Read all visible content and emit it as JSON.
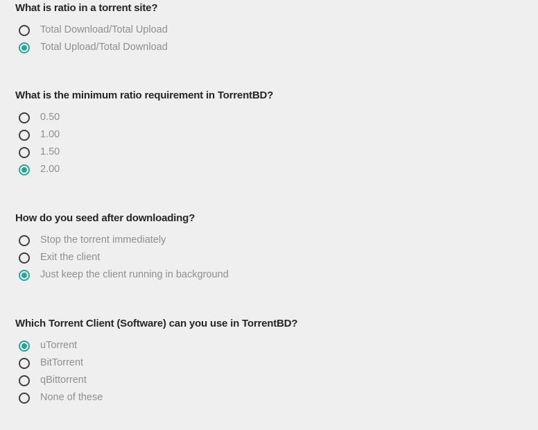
{
  "questions": [
    {
      "title": "What is ratio in a torrent site?",
      "options": [
        {
          "label": "Total Download/Total Upload",
          "checked": false
        },
        {
          "label": "Total Upload/Total Download",
          "checked": true
        }
      ]
    },
    {
      "title": "What is the minimum ratio requirement in TorrentBD?",
      "options": [
        {
          "label": "0.50",
          "checked": false
        },
        {
          "label": "1.00",
          "checked": false
        },
        {
          "label": "1.50",
          "checked": false
        },
        {
          "label": "2.00",
          "checked": true
        }
      ]
    },
    {
      "title": "How do you seed after downloading?",
      "options": [
        {
          "label": "Stop the torrent immediately",
          "checked": false
        },
        {
          "label": "Exit the client",
          "checked": false
        },
        {
          "label": "Just keep the client running in background",
          "checked": true
        }
      ]
    },
    {
      "title": "Which Torrent Client (Software) can you use in TorrentBD?",
      "options": [
        {
          "label": "uTorrent",
          "checked": true
        },
        {
          "label": "BitTorrent",
          "checked": false
        },
        {
          "label": "qBittorrent",
          "checked": false
        },
        {
          "label": "None of these",
          "checked": false
        }
      ]
    }
  ],
  "colors": {
    "background": "#efefef",
    "accent": "#26a69a",
    "question_text": "#262626",
    "option_text": "#8f8f8f",
    "radio_border": "#3f3f3f"
  }
}
